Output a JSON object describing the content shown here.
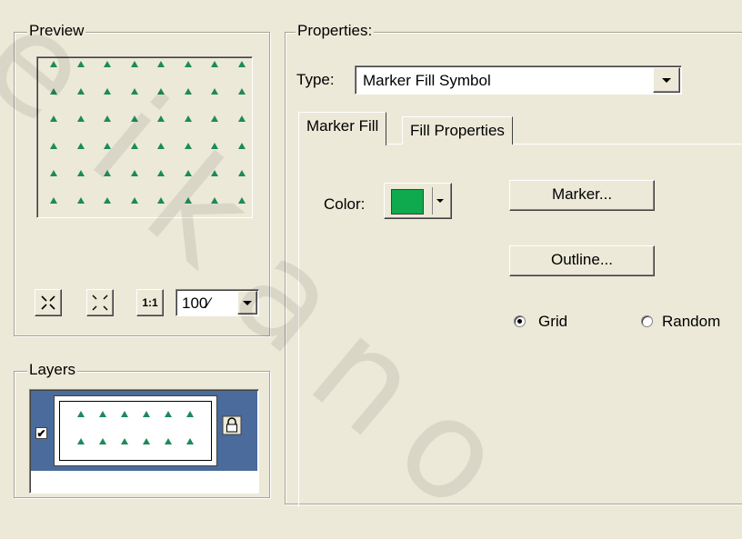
{
  "preview": {
    "legend": "Preview",
    "zoom_value": "100⁄",
    "marker_color": "#1d8a5b",
    "toolbar_icons": [
      "zoom-in-icon",
      "zoom-out-icon",
      "actual-size-icon"
    ],
    "actual_size_label": "1:1"
  },
  "layers": {
    "legend": "Layers",
    "checkbox_glyph": "✔",
    "selected_color": "#4a6b9b"
  },
  "properties": {
    "legend": "Properties:",
    "type_label": "Type:",
    "type_value": "Marker Fill Symbol",
    "tabs": [
      {
        "label": "Marker Fill",
        "active": true
      },
      {
        "label": "Fill Properties",
        "active": false
      }
    ],
    "color_label": "Color:",
    "color_value": "#0fa94e",
    "marker_button": "Marker...",
    "outline_button": "Outline...",
    "radio_options": [
      {
        "label": "Grid",
        "checked": true
      },
      {
        "label": "Random",
        "checked": false
      }
    ]
  },
  "watermark": [
    "e",
    "i",
    "k",
    "a",
    "n",
    "o"
  ]
}
